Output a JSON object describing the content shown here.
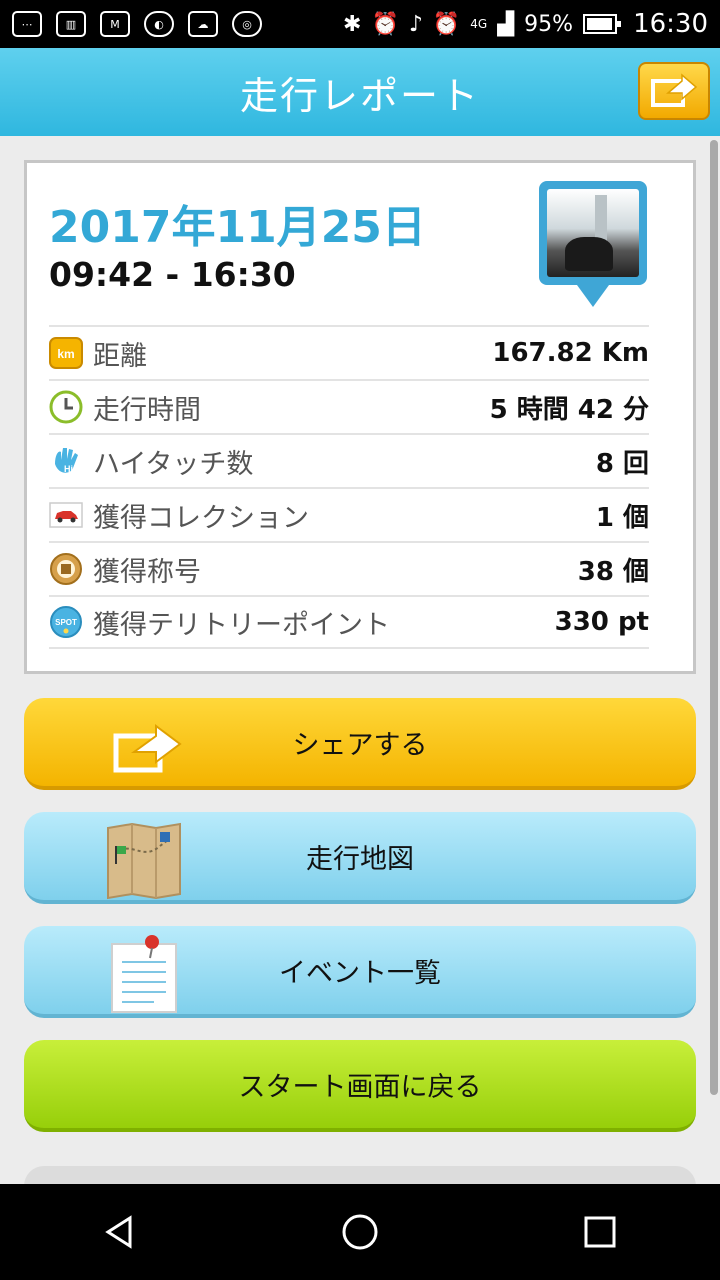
{
  "status_bar": {
    "network": "4G",
    "battery_text": "95%",
    "battery_level": 0.95,
    "time": "16:30",
    "icons": [
      "keyboard-icon",
      "equalizer-icon",
      "gmail-icon",
      "app-notification-icon",
      "cloud-icon",
      "nfc-on-icon",
      "bluetooth-icon",
      "alarm-icon",
      "music-icon",
      "alarm-icon",
      "signal-icon",
      "battery-icon"
    ]
  },
  "header": {
    "title": "走行レポート",
    "share_icon": "share-arrow-icon"
  },
  "report": {
    "date": "2017年11月25日",
    "time_range": "09:42 - 16:30",
    "photo_icon": "photo-pin-icon",
    "stats": [
      {
        "icon": "km-icon",
        "label": "距離",
        "value": "167.82 Km"
      },
      {
        "icon": "clock-icon",
        "label": "走行時間",
        "value": "5 時間 42 分"
      },
      {
        "icon": "high-touch-hand-icon",
        "label": "ハイタッチ数",
        "value": "8 回"
      },
      {
        "icon": "car-collection-icon",
        "label": "獲得コレクション",
        "value": "1 個"
      },
      {
        "icon": "medal-icon",
        "label": "獲得称号",
        "value": "38 個"
      },
      {
        "icon": "spot-icon",
        "label": "獲得テリトリーポイント",
        "value": "330 pt"
      }
    ]
  },
  "buttons": {
    "share": "シェアする",
    "map": "走行地図",
    "events": "イベント一覧",
    "start": "スタート画面に戻る"
  },
  "colors": {
    "header": "#2fb7df",
    "date": "#33a8d6",
    "share_button": "#f4b400",
    "map_button": "#7fd0ec",
    "start_button": "#97cf0a"
  }
}
